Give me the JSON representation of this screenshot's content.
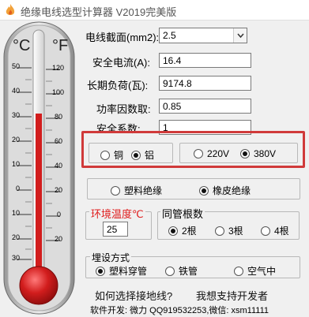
{
  "window": {
    "title": "绝缘电线选型计算器 V2019完美版",
    "icon": "flame-icon"
  },
  "thermometer": {
    "celsius_symbol": "°C",
    "fahrenheit_symbol": "°F",
    "celsius_ticks": [
      "50",
      "40",
      "30",
      "20",
      "10",
      "0",
      "10",
      "20",
      "30"
    ],
    "fahrenheit_ticks": [
      "120",
      "100",
      "80",
      "60",
      "40",
      "20",
      "0",
      "20"
    ],
    "mercury_color": "#d21d1d",
    "bulb_color": "#c81818"
  },
  "form": {
    "cross_section": {
      "label": "电线截面(mm2):",
      "value": "2.5"
    },
    "safe_current": {
      "label": "安全电流(A):",
      "value": "16.4"
    },
    "long_load": {
      "label": "长期负荷(瓦):",
      "value": "9174.8"
    },
    "power_factor": {
      "label": "功率因数取:",
      "value": "0.85"
    },
    "safety_factor": {
      "label": "安全系数:",
      "value": "1"
    }
  },
  "material": {
    "options": [
      "铜",
      "铝"
    ],
    "selected": "铝"
  },
  "voltage": {
    "options": [
      "220V",
      "380V"
    ],
    "selected": "380V"
  },
  "insulation": {
    "options": [
      "塑料绝缘",
      "橡皮绝缘"
    ],
    "selected": "橡皮绝缘"
  },
  "ambient": {
    "label": "环境温度℃",
    "value": "25",
    "label_color": "#e01b1b"
  },
  "conduit_count": {
    "label": "同管根数",
    "options": [
      "2根",
      "3根",
      "4根"
    ],
    "selected": "2根"
  },
  "laying": {
    "label": "埋设方式",
    "options": [
      "塑料穿管",
      "铁管",
      "空气中"
    ],
    "selected": "塑料穿管"
  },
  "links": {
    "ground_wire": "如何选择接地线?",
    "support": "我想支持开发者"
  },
  "footer": {
    "developer": "软件开发: 微力 QQ919532253,微信: xsm11111"
  },
  "accent": {
    "highlight_border": "#d03a3a"
  }
}
